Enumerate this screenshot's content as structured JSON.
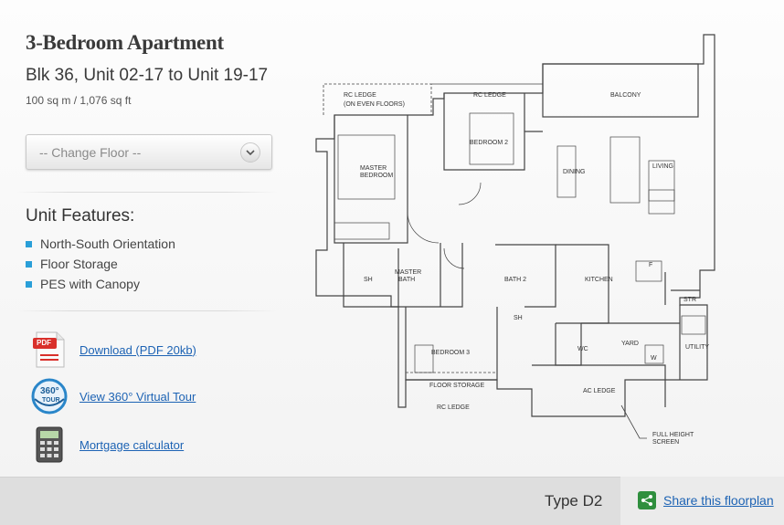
{
  "header": {
    "title": "3-Bedroom Apartment",
    "unit_range": "Blk 36, Unit 02-17 to Unit 19-17",
    "area": "100 sq m / 1,076 sq ft"
  },
  "floor_select": {
    "value": "-- Change Floor --"
  },
  "features": {
    "heading": "Unit Features:",
    "items": [
      "North-South Orientation",
      "Floor Storage",
      "PES with Canopy"
    ]
  },
  "links": {
    "download": "Download (PDF 20kb)",
    "pdf_badge": "PDF",
    "tour": "View 360° Virtual Tour",
    "tour_badge_top": "360°",
    "tour_badge_bottom": "TOUR",
    "mortgage": "Mortgage calculator"
  },
  "footer": {
    "type": "Type D2",
    "share": "Share this floorplan"
  },
  "floorplan": {
    "rc_ledge_even": "RC LEDGE",
    "rc_ledge_even_note": "(ON EVEN FLOORS)",
    "rc_ledge_top": "RC LEDGE",
    "balcony": "BALCONY",
    "bedroom2": "BEDROOM 2",
    "master": "MASTER",
    "bedroom": "BEDROOM",
    "dining": "DINING",
    "living": "LIVING",
    "sh1": "SH",
    "master_bath_1": "MASTER",
    "master_bath_2": "BATH",
    "bath2": "BATH 2",
    "kitchen": "KITCHEN",
    "f": "F",
    "str": "STR",
    "sh2": "SH",
    "wc": "WC",
    "yard": "YARD",
    "utility": "UTILITY",
    "w": "W",
    "bedroom3": "BEDROOM 3",
    "floor_storage": "FLOOR STORAGE",
    "ac_ledge": "AC LEDGE",
    "rc_ledge_bottom": "RC LEDGE",
    "full_height_1": "FULL HEIGHT",
    "full_height_2": "SCREEN"
  },
  "colors": {
    "link": "#1d63b4",
    "bullet": "#2a9fd8",
    "footer_bg": "#dedede",
    "share_icon": "#2f8f3e"
  }
}
